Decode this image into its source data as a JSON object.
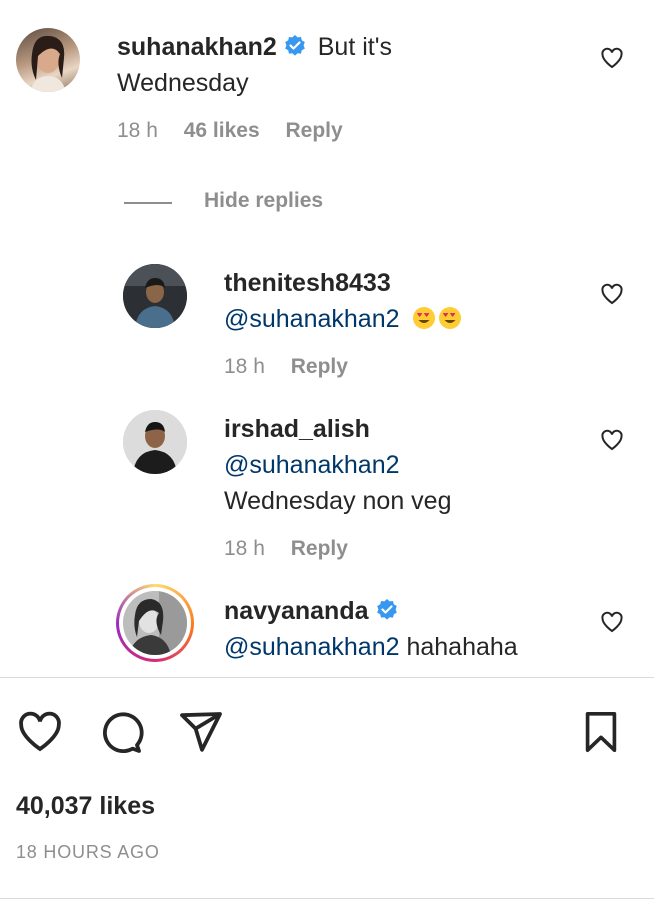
{
  "comment_main": {
    "username": "suhanakhan2",
    "text_line1": "But it's",
    "text_line2": "Wednesday",
    "time": "18 h",
    "likes": "46 likes",
    "reply": "Reply"
  },
  "hide_replies": "Hide replies",
  "replies": [
    {
      "username": "thenitesh8433",
      "mention": "@suhanakhan2",
      "text": "",
      "time": "18 h",
      "reply": "Reply"
    },
    {
      "username": "irshad_alish",
      "mention": "@suhanakhan2",
      "text": "Wednesday non veg",
      "time": "18 h",
      "reply": "Reply"
    },
    {
      "username": "navyananda",
      "mention": "@suhanakhan2",
      "text": "hahahaha"
    }
  ],
  "footer": {
    "likes": "40,037 likes",
    "timestamp": "18 HOURS AGO"
  },
  "colors": {
    "verified": "#3897f0",
    "mention": "#00376b",
    "muted": "#8e8e8e",
    "story_ring_start": "#feda75",
    "story_ring_end": "#d62976"
  }
}
